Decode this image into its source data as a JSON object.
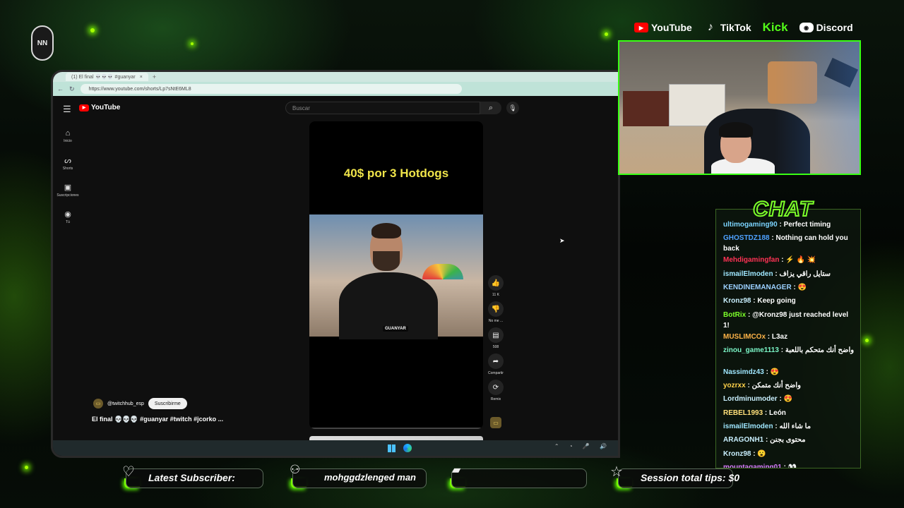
{
  "overlay": {
    "logo_text": "NN",
    "socials": [
      {
        "name": "YouTube",
        "icon": "youtube-icon"
      },
      {
        "name": "TikTok",
        "icon": "tiktok-icon"
      },
      {
        "name": "Kick",
        "icon": "kick-icon"
      },
      {
        "name": "Discord",
        "icon": "discord-icon"
      }
    ],
    "accent_color": "#7cff00"
  },
  "browser": {
    "tab_title": "(1) El final 💀💀💀 #guanyar",
    "url": "https://www.youtube.com/shorts/Lp7sNtE6ML8"
  },
  "youtube": {
    "logo_text": "YouTube",
    "search_placeholder": "Buscar",
    "sidebar": [
      {
        "label": "Inicio",
        "icon": "home-icon"
      },
      {
        "label": "Shorts",
        "icon": "shorts-icon"
      },
      {
        "label": "Suscripciones",
        "icon": "subscriptions-icon"
      },
      {
        "label": "Tú",
        "icon": "you-icon"
      }
    ],
    "short": {
      "title": "40$ por 3 Hotdogs",
      "watermark": "GUANYAR",
      "channel": "@twitchhub_esp",
      "subscribe_label": "Suscribirme",
      "caption": "El final 💀💀💀 #guanyar #twitch #jcorko ..."
    },
    "actions": {
      "like_count": "11 K",
      "dislike_label": "No me ...",
      "comments_count": "508",
      "share_label": "Compartir",
      "remix_label": "Remix"
    }
  },
  "chat": {
    "title": "CHAT",
    "messages": [
      {
        "user": "ultimogaming90",
        "color": "#7bd4ff",
        "text": "Perfect timing"
      },
      {
        "user": "GHOSTDZ188",
        "color": "#4ea1ff",
        "text": "Nothing can hold you back"
      },
      {
        "user": "Mehdigamingfan",
        "color": "#ff3355",
        "text": "⚡ 🔥 💥"
      },
      {
        "user": "ismailElmoden",
        "color": "#9fe7ff",
        "text": "ستايل راقي يزاف"
      },
      {
        "user": "KENDINEMANAGER",
        "color": "#9bd0ff",
        "text": "😍"
      },
      {
        "user": "Kronz98",
        "color": "#c9f0ff",
        "text": "Keep going"
      },
      {
        "user": "BotRix",
        "color": "#7cff2a",
        "text": "@Kronz98 just reached level 1!"
      },
      {
        "user": "MUSLIMCOx",
        "color": "#ffb347",
        "text": "L3az"
      },
      {
        "user": "zinou_game1113",
        "color": "#7cf7c8",
        "text": "واضح أنك متحكم باللعبة"
      },
      {
        "user": "Nassimdz43",
        "color": "#9fe7ff",
        "text": "😍"
      },
      {
        "user": "yozrxx",
        "color": "#ffd24a",
        "text": "واضح أنك متمكن"
      },
      {
        "user": "Lordminumoder",
        "color": "#c9f0ff",
        "text": "😍"
      },
      {
        "user": "REBEL1993",
        "color": "#ffe07a",
        "text": "León"
      },
      {
        "user": "ismailElmoden",
        "color": "#9fe7ff",
        "text": "ما شاء الله"
      },
      {
        "user": "ARAGONH1",
        "color": "#c9f0ff",
        "text": "محتوى بجنن"
      },
      {
        "user": "Kronz98",
        "color": "#c9f0ff",
        "text": "😮"
      },
      {
        "user": "mountagaming01",
        "color": "#d87cff",
        "text": "👀"
      }
    ]
  },
  "bottom_bar": {
    "latest_subscriber_label": "Latest Subscriber:",
    "ticker_text": "mohggdzlenged   man",
    "session_tips": "Session total tips: $0"
  }
}
